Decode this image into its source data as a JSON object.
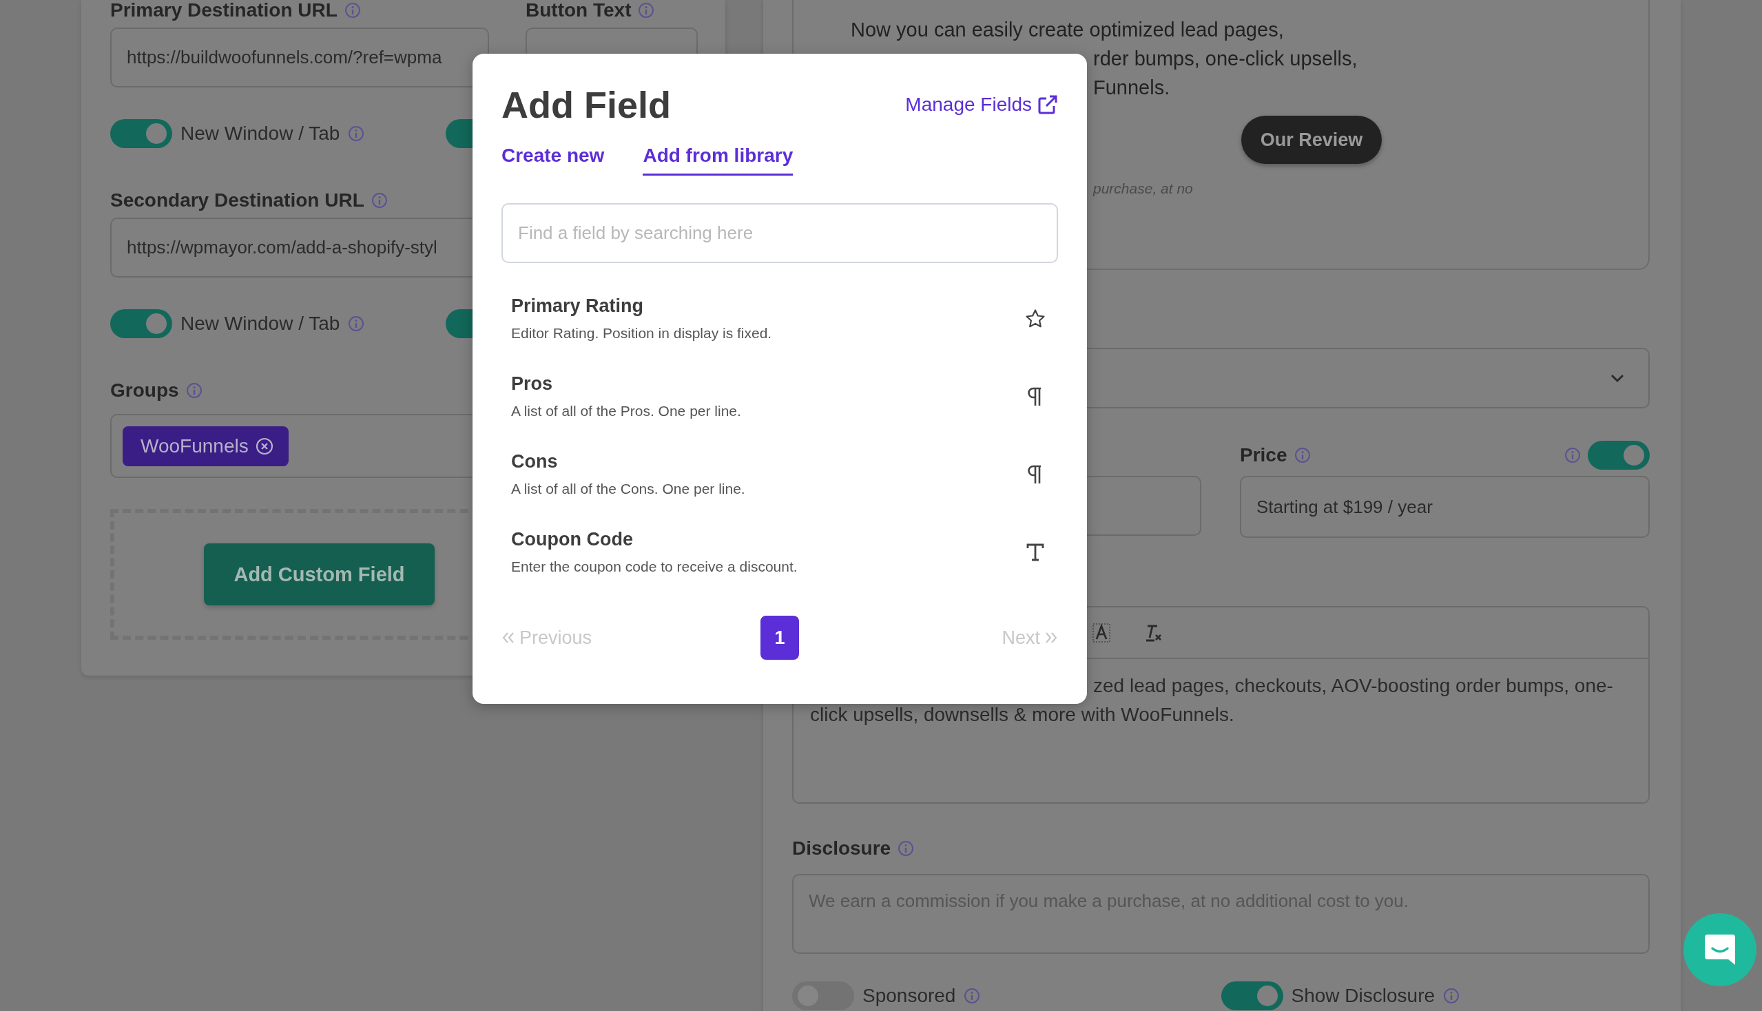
{
  "left_panel": {
    "primary_url": {
      "label": "Primary Destination URL",
      "value": "https://buildwoofunnels.com/?ref=wpma"
    },
    "button_text": {
      "label": "Button Text"
    },
    "primary_toggles": [
      {
        "label": "New Window / Tab",
        "on": true
      },
      {
        "on": true
      }
    ],
    "secondary_url": {
      "label": "Secondary Destination URL",
      "value": "https://wpmayor.com/add-a-shopify-styl"
    },
    "secondary_toggles": [
      {
        "label": "New Window / Tab",
        "on": true
      },
      {
        "on": true
      }
    ],
    "groups": {
      "label": "Groups",
      "tags": [
        "WooFunnels"
      ]
    },
    "add_button": "Add Custom Field"
  },
  "right_panel": {
    "preview": {
      "lines": [
        "Now you can easily create optimized lead pages,",
        "rder bumps, one-click upsells,",
        "Funnels."
      ],
      "button": "Our Review",
      "note": "purchase, at no"
    },
    "price": {
      "label": "Price",
      "toggle_on": true,
      "value": "Starting at $199 / year"
    },
    "description": {
      "lines": [
        "zed lead pages, checkouts, AOV-boosting order bumps, one-",
        "click upsells, downsells & more with WooFunnels."
      ]
    },
    "disclosure": {
      "label": "Disclosure",
      "placeholder": "We earn a commission if you make a purchase, at no additional cost to you."
    },
    "toggles": [
      {
        "label": "Sponsored",
        "on": false
      },
      {
        "label": "Show Disclosure",
        "on": true
      }
    ]
  },
  "modal": {
    "title": "Add Field",
    "manage_link": "Manage Fields",
    "tabs": [
      {
        "label": "Create new",
        "selected": false
      },
      {
        "label": "Add from library",
        "selected": true
      }
    ],
    "search": {
      "placeholder": "Find a field by searching here"
    },
    "fields": [
      {
        "title": "Primary Rating",
        "description": "Editor Rating. Position in display is fixed.",
        "kind": "star"
      },
      {
        "title": "Pros",
        "description": "A list of all of the Pros. One per line.",
        "kind": "paragraph"
      },
      {
        "title": "Cons",
        "description": "A list of all of the Cons. One per line.",
        "kind": "paragraph"
      },
      {
        "title": "Coupon Code",
        "description": "Enter the coupon code to receive a discount.",
        "kind": "text"
      }
    ],
    "pagination": {
      "previous": {
        "label": "Previous",
        "disabled": true
      },
      "pages": [
        {
          "label": "1",
          "selected": true
        }
      ],
      "next": {
        "label": "Next",
        "disabled": true
      }
    }
  }
}
